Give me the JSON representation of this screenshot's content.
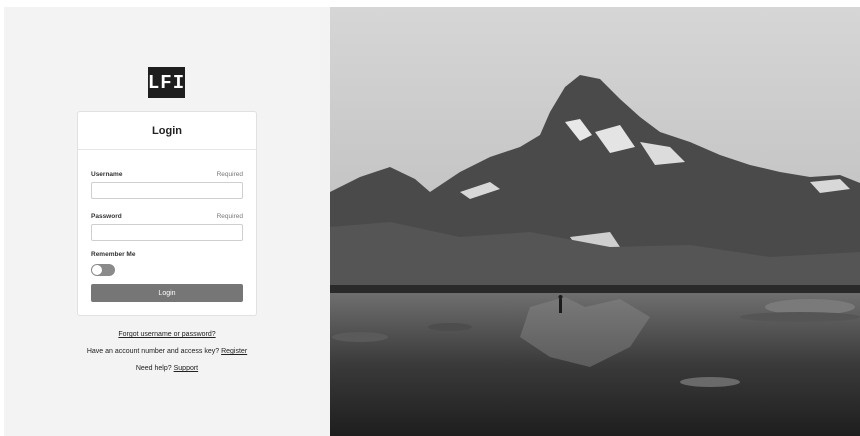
{
  "logo": {
    "text": "LFI"
  },
  "login_card": {
    "title": "Login",
    "username_label": "Username",
    "username_required": "Required",
    "username_value": "",
    "password_label": "Password",
    "password_required": "Required",
    "password_value": "",
    "remember_label": "Remember Me",
    "remember_on": false,
    "submit_label": "Login"
  },
  "links": {
    "forgot": "Forgot username or password?",
    "register_prefix": "Have an account number and access key?",
    "register_link": "Register",
    "help_prefix": "Need help?",
    "help_link": "Support"
  },
  "colors": {
    "panel_bg": "#f3f3f3",
    "button_bg": "#767676",
    "logo_bg": "#1e1e1e"
  },
  "hero_image": {
    "subject": "black-and-white mountain lake landscape"
  }
}
